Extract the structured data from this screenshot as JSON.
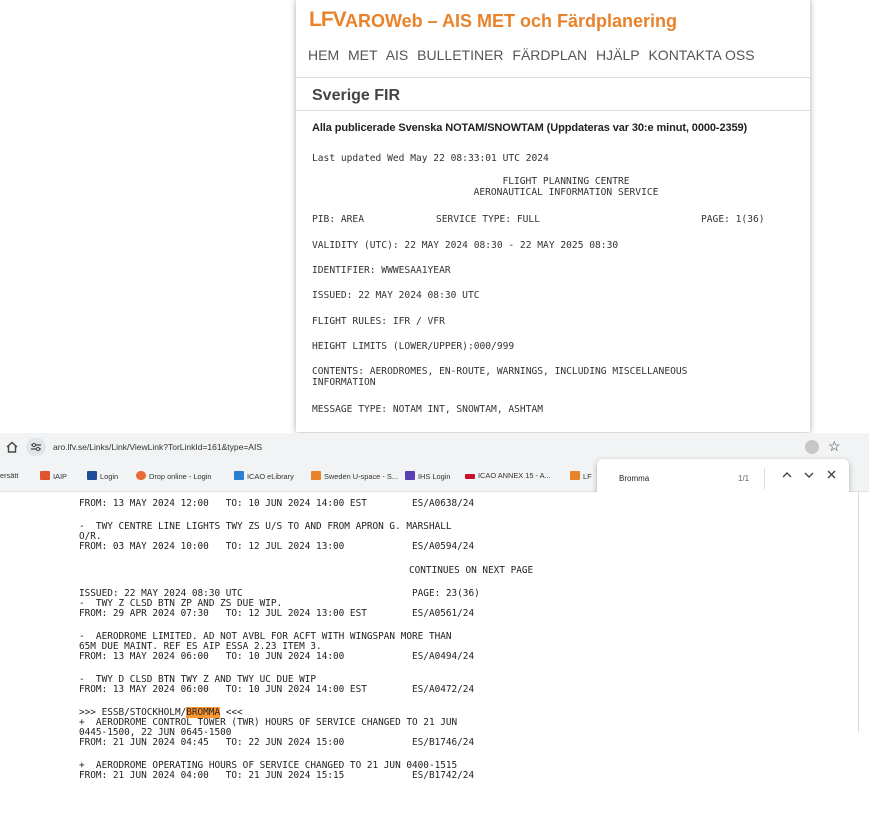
{
  "aroweb": {
    "logo": "LFV",
    "title": "AROWeb – AIS MET och Färdplanering",
    "nav": [
      "HEM",
      "MET",
      "AIS",
      "BULLETINER",
      "FÄRDPLAN",
      "HJÄLP",
      "KONTAKTA OSS"
    ],
    "fir_title": "Sverige FIR",
    "notam_heading": "Alla publicerade Svenska NOTAM/SNOWTAM (Uppdateras var 30:e minut, 0000-2359)",
    "last_updated": "Last updated Wed May 22 08:33:01 UTC 2024",
    "centre_line1": "FLIGHT PLANNING CENTRE",
    "centre_line2": "AERONAUTICAL INFORMATION SERVICE",
    "pib": "PIB: AREA",
    "service_type": "SERVICE TYPE: FULL",
    "page": "PAGE: 1(36)",
    "validity": "VALIDITY (UTC): 22 MAY 2024 08:30 - 22 MAY 2025 08:30",
    "identifier": "IDENTIFIER: WWWESAA1YEAR",
    "issued": "ISSUED: 22 MAY 2024 08:30 UTC",
    "flight_rules": "FLIGHT RULES: IFR / VFR",
    "height_limits": "HEIGHT LIMITS (LOWER/UPPER):000/999",
    "contents_1": "CONTENTS: AERODROMES, EN-ROUTE, WARNINGS, INCLUDING MISCELLANEOUS",
    "contents_2": "INFORMATION",
    "message_type": "MESSAGE TYPE: NOTAM INT, SNOWTAM, ASHTAM"
  },
  "browser": {
    "url": "aro.lfv.se/Links/Link/ViewLink?TorLinkId=161&type=AIS",
    "bookmarks": [
      "ersätt",
      "IAIP",
      "Login",
      "Drop online - Login",
      "ICAO eLibrary",
      "Sweden U-space - S...",
      "IHS Login",
      "ICAO ANNEX 15 - A...",
      "LF"
    ],
    "find": {
      "query": "Bromma",
      "count": "1/1"
    }
  },
  "notam": {
    "l1": "FROM: 13 MAY 2024 12:00   TO: 10 JUN 2024 14:00 EST        ES/A0638/24",
    "l2": "-  TWY CENTRE LINE LIGHTS TWY ZS U/S TO AND FROM APRON G. MARSHALL",
    "l3": "O/R.",
    "l4": "FROM: 03 MAY 2024 10:00   TO: 12 JUL 2024 13:00            ES/A0594/24",
    "l5": "CONTINUES ON NEXT PAGE",
    "l6": "ISSUED: 22 MAY 2024 08:30 UTC                              PAGE: 23(36)",
    "l7": "-  TWY Z CLSD BTN ZP AND ZS DUE WIP.",
    "l8": "FROM: 29 APR 2024 07:30   TO: 12 JUL 2024 13:00 EST        ES/A0561/24",
    "l9": "-  AERODROME LIMITED. AD NOT AVBL FOR ACFT WITH WINGSPAN MORE THAN",
    "l10": "65M DUE MAINT. REF ES AIP ESSA 2.23 ITEM 3.",
    "l11": "FROM: 13 MAY 2024 06:00   TO: 10 JUN 2024 14:00            ES/A0494/24",
    "l12": "-  TWY D CLSD BTN TWY Z AND TWY UC DUE WIP",
    "l13": "FROM: 13 MAY 2024 06:00   TO: 10 JUN 2024 14:00 EST        ES/A0472/24",
    "l14_a": ">>> ESSB/STOCKHOLM/",
    "l14_b": "BROMMA",
    "l14_c": " <<<",
    "l15": "+  AERODROME CONTROL TOWER (TWR) HOURS OF SERVICE CHANGED TO 21 JUN",
    "l16": "0445-1500, 22 JUN 0645-1500",
    "l17": "FROM: 21 JUN 2024 04:45   TO: 22 JUN 2024 15:00            ES/B1746/24",
    "l18": "+  AERODROME OPERATING HOURS OF SERVICE CHANGED TO 21 JUN 0400-1515",
    "l19": "FROM: 21 JUN 2024 04:00   TO: 21 JUN 2024 15:15            ES/B1742/24"
  }
}
